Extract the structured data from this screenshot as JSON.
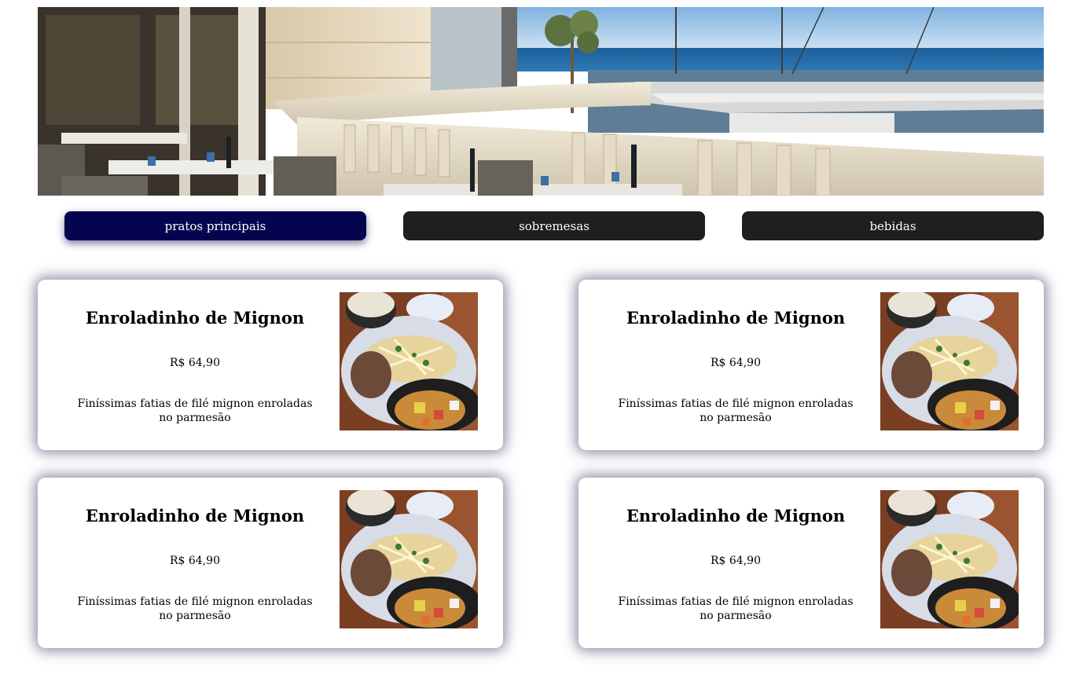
{
  "banner": {
    "image": "restaurant-terrace-sea-view"
  },
  "tabs": [
    {
      "label": "pratos principais",
      "active": true
    },
    {
      "label": "sobremesas",
      "active": false
    },
    {
      "label": "bebidas",
      "active": false
    }
  ],
  "menu_items": [
    {
      "name": "Enroladinho de Mignon",
      "price": "R$ 64,90",
      "description": "Finíssimas fatias de filé mignon enroladas no parmesão",
      "image": "mignon-dish-photo"
    },
    {
      "name": "Enroladinho de Mignon",
      "price": "R$ 64,90",
      "description": "Finíssimas fatias de filé mignon enroladas no parmesão",
      "image": "mignon-dish-photo"
    },
    {
      "name": "Enroladinho de Mignon",
      "price": "R$ 64,90",
      "description": "Finíssimas fatias de filé mignon enroladas no parmesão",
      "image": "mignon-dish-photo"
    },
    {
      "name": "Enroladinho de Mignon",
      "price": "R$ 64,90",
      "description": "Finíssimas fatias de filé mignon enroladas no parmesão",
      "image": "mignon-dish-photo"
    }
  ],
  "colors": {
    "tab_active": "#05054f",
    "tab_inactive": "#1f1f1f",
    "card_shadow": "#3c325f"
  }
}
